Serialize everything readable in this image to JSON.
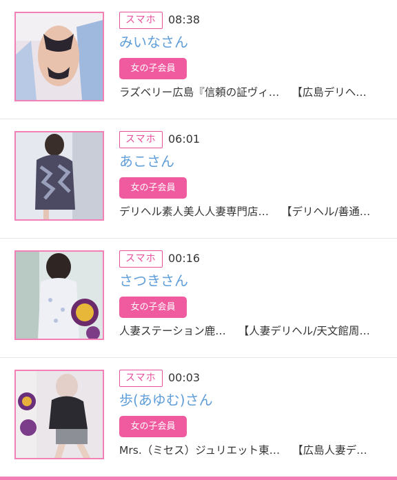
{
  "items": [
    {
      "badge": "スマホ",
      "time": "08:38",
      "name": "みいなさん",
      "member_label": "女の子会員",
      "shop_name": "ラズベリー広島『信頼の証ヴィ…",
      "shop_area": "【広島デリヘ…"
    },
    {
      "badge": "スマホ",
      "time": "06:01",
      "name": "あこさん",
      "member_label": "女の子会員",
      "shop_name": "デリヘル素人美人人妻専門店…",
      "shop_area": "【デリヘル/善通…"
    },
    {
      "badge": "スマホ",
      "time": "00:16",
      "name": "さつきさん",
      "member_label": "女の子会員",
      "shop_name": "人妻ステーション鹿…",
      "shop_area": "【人妻デリヘル/天文館周…"
    },
    {
      "badge": "スマホ",
      "time": "00:03",
      "name": "歩(あゆむ)さん",
      "member_label": "女の子会員",
      "shop_name": "Mrs.（ミセス）ジュリエット東…",
      "shop_area": "【広島人妻デ…"
    }
  ],
  "colors": {
    "accent_pink": "#f05a9f",
    "badge_pink": "#e84f9c",
    "frame_pink": "#f27fb5",
    "name_blue": "#5f9ed8"
  }
}
